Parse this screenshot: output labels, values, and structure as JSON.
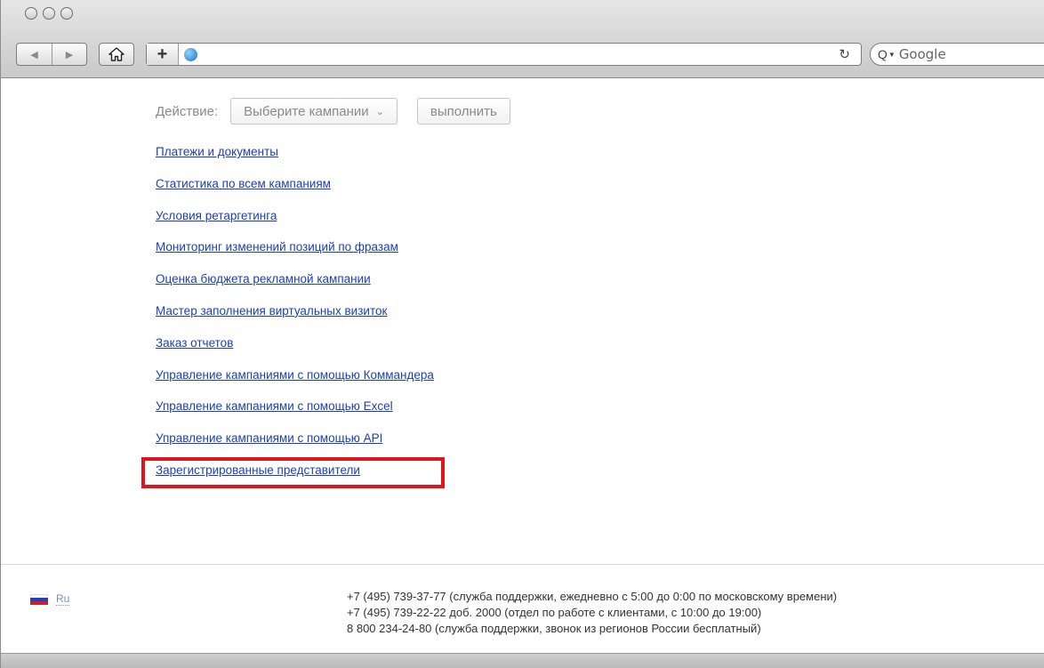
{
  "browser": {
    "search_placeholder": "Google",
    "search_logo": "Q"
  },
  "action": {
    "label": "Действие:",
    "select_value": "Выберите кампании",
    "execute_label": "выполнить"
  },
  "links": [
    "Платежи и документы",
    "Статистика по всем кампаниям",
    "Условия ретаргетинга",
    "Мониторинг изменений позиций по фразам",
    "Оценка бюджета рекламной кампании",
    "Мастер заполнения виртуальных визиток",
    "Заказ отчетов",
    "Управление кампаниями с помощью Коммандера",
    "Управление кампаниями с помощью Excel",
    "Управление кампаниями с помощью API",
    "Зарегистрированные представители"
  ],
  "highlighted_link_index": 10,
  "footer": {
    "language": "Ru",
    "contacts": [
      "+7 (495) 739-37-77 (служба поддержки, ежедневно с 5:00 до 0:00 по московскому времени)",
      "+7 (495) 739-22-22 доб. 2000 (отдел по работе с клиентами, с 10:00 до 19:00)",
      "8 800 234-24-80 (служба поддержки, звонок из регионов России бесплатный)"
    ]
  },
  "colors": {
    "link": "#1a3fb8",
    "highlight": "#e0151c",
    "muted_text": "#8a8a8a"
  }
}
